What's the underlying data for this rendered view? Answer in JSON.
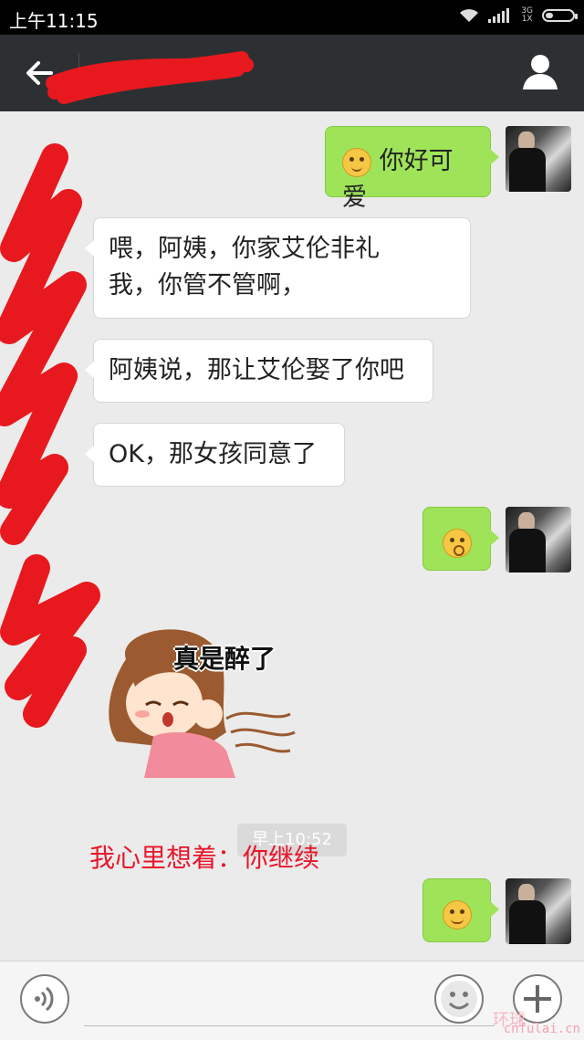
{
  "status_bar": {
    "time": "上午11:15",
    "network_top": "3G",
    "network_bottom": "1X"
  },
  "header": {
    "back_icon": "arrow-left-icon",
    "profile_icon": "person-icon"
  },
  "messages": [
    {
      "side": "out",
      "text": "你好可爱",
      "emoji": "yum-emoji"
    },
    {
      "side": "in",
      "line1": "喂，阿姨，你家艾伦非礼",
      "line2": "我，你管不管啊，"
    },
    {
      "side": "in",
      "text": "阿姨说，那让艾伦娶了你吧"
    },
    {
      "side": "in",
      "text": "OK，那女孩同意了"
    },
    {
      "side": "out",
      "emoji": "surprised-emoji"
    },
    {
      "side": "in",
      "sticker_text": "真是醉了"
    },
    {
      "side": "out",
      "emoji": "smirk-emoji"
    }
  ],
  "timestamp": "早上10:52",
  "caption": "我心里想着：你继续",
  "input_bar": {
    "voice_icon": "voice-icon",
    "emoji_icon": "smiley-icon",
    "plus_icon": "plus-icon"
  },
  "watermark": {
    "logo": "环球",
    "site": "cnfulai.cn"
  },
  "colors": {
    "outgoing_bubble": "#9fe458",
    "incoming_bubble": "#ffffff",
    "header": "#2d3033",
    "caption": "#e8162a"
  }
}
